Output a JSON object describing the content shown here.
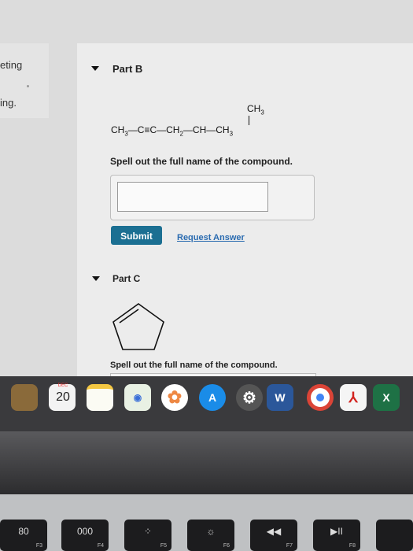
{
  "sidebar": {
    "fragment_1": "eting",
    "fragment_2": "ing."
  },
  "part_b": {
    "title": "Part B",
    "formula": {
      "branch": "CH3",
      "chain": "CH3—C≡C—CH2—CH—CH3"
    },
    "instruction": "Spell out the full name of the compound.",
    "answer_value": "",
    "submit_label": "Submit",
    "request_label": "Request Answer"
  },
  "part_c": {
    "title": "Part C",
    "instruction": "Spell out the full name of the compound."
  },
  "dock": {
    "calendar_month": "DEC",
    "calendar_day": "20",
    "word_label": "W",
    "excel_label": "X"
  },
  "keyboard": {
    "keys": [
      {
        "glyph": "80",
        "label": "F3"
      },
      {
        "glyph": "000",
        "label": "F4"
      },
      {
        "glyph": "",
        "label": "F5"
      },
      {
        "glyph": "",
        "label": "F6"
      },
      {
        "glyph": "◀◀",
        "label": "F7"
      },
      {
        "glyph": "▶II",
        "label": "F8"
      }
    ]
  },
  "colors": {
    "submit": "#1b6f92",
    "link": "#2a6bb0",
    "word": "#2b579a",
    "excel": "#1e7145",
    "appstore": "#1a8ce8"
  }
}
